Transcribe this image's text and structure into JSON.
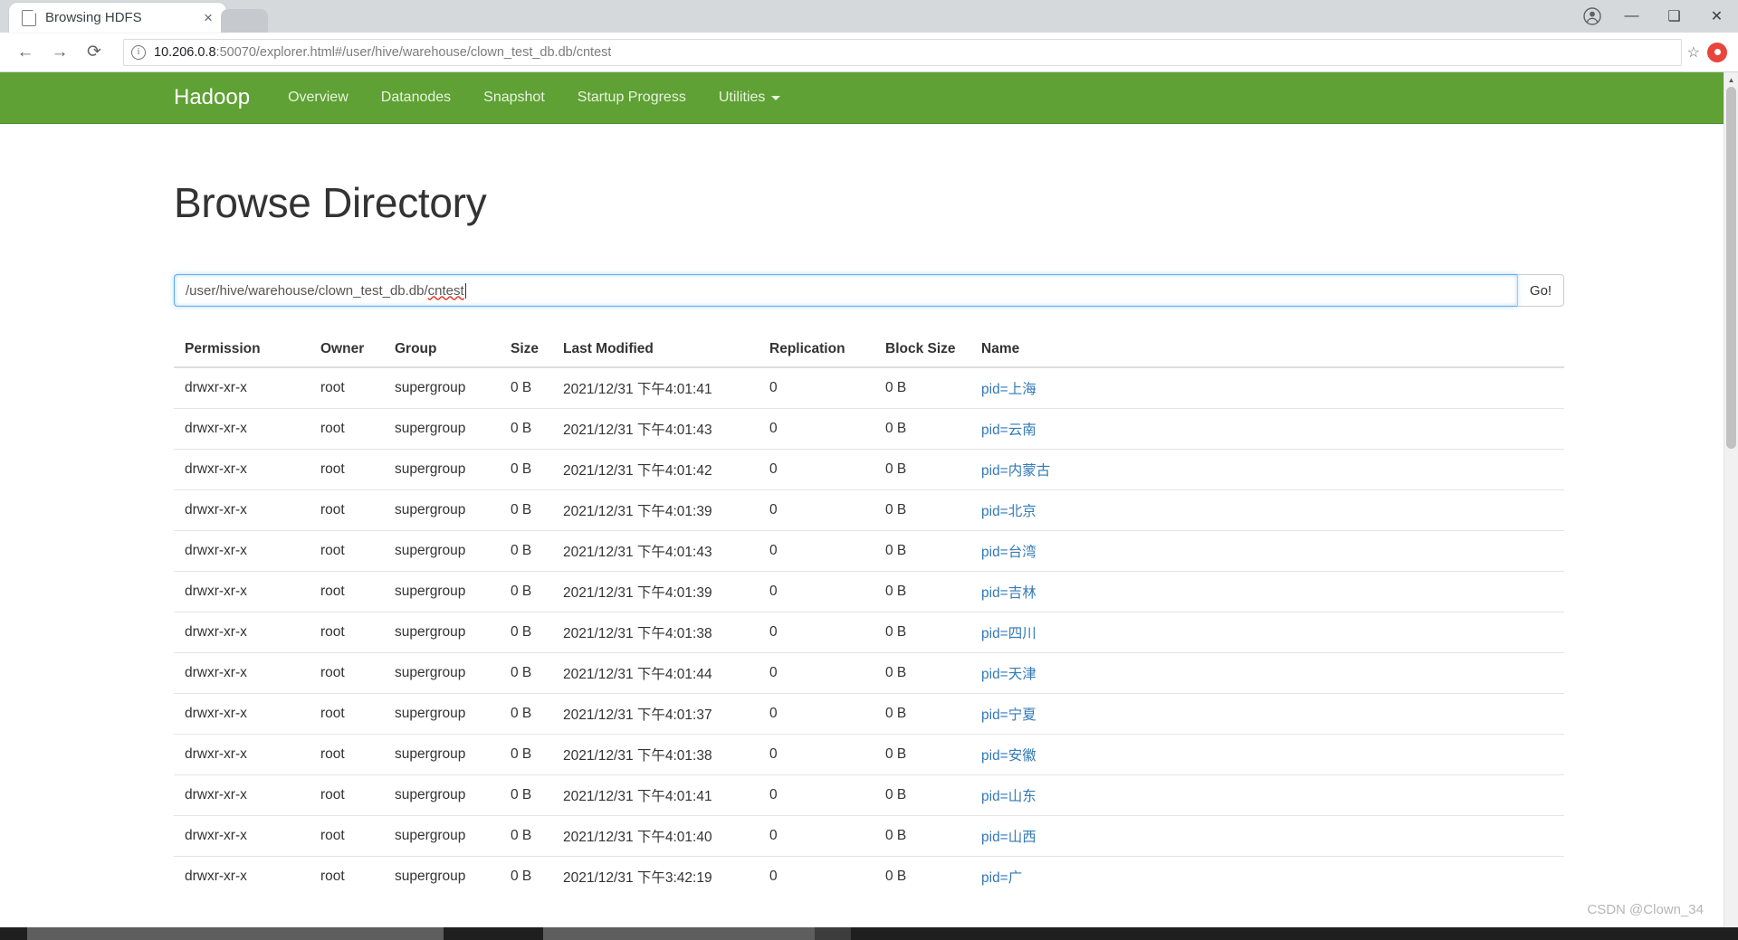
{
  "browser": {
    "tab_title": "Browsing HDFS",
    "tab_close": "×",
    "back_icon": "←",
    "forward_icon": "→",
    "reload_icon": "⟳",
    "info_icon": "i",
    "url_host": "10.206.0.8",
    "url_rest": ":50070/explorer.html#/user/hive/warehouse/clown_test_db.db/cntest",
    "star_icon": "☆",
    "profile_icon": "●",
    "minimize_label": "—",
    "maximize_label": "❑",
    "close_label": "✕"
  },
  "navbar": {
    "brand": "Hadoop",
    "links": [
      {
        "label": "Overview"
      },
      {
        "label": "Datanodes"
      },
      {
        "label": "Snapshot"
      },
      {
        "label": "Startup Progress"
      },
      {
        "label": "Utilities",
        "has_caret": true
      }
    ],
    "background": "#5fa134"
  },
  "page": {
    "title": "Browse Directory",
    "path_value": "/user/hive/warehouse/clown_test_db.db/",
    "path_value_misspelled": "cntest",
    "go_label": "Go!"
  },
  "table": {
    "headers": [
      "Permission",
      "Owner",
      "Group",
      "Size",
      "Last Modified",
      "Replication",
      "Block Size",
      "Name"
    ],
    "rows": [
      {
        "permission": "drwxr-xr-x",
        "owner": "root",
        "group": "supergroup",
        "size": "0 B",
        "modified": "2021/12/31 下午4:01:41",
        "replication": "0",
        "block_size": "0 B",
        "name": "pid=上海"
      },
      {
        "permission": "drwxr-xr-x",
        "owner": "root",
        "group": "supergroup",
        "size": "0 B",
        "modified": "2021/12/31 下午4:01:43",
        "replication": "0",
        "block_size": "0 B",
        "name": "pid=云南"
      },
      {
        "permission": "drwxr-xr-x",
        "owner": "root",
        "group": "supergroup",
        "size": "0 B",
        "modified": "2021/12/31 下午4:01:42",
        "replication": "0",
        "block_size": "0 B",
        "name": "pid=内蒙古"
      },
      {
        "permission": "drwxr-xr-x",
        "owner": "root",
        "group": "supergroup",
        "size": "0 B",
        "modified": "2021/12/31 下午4:01:39",
        "replication": "0",
        "block_size": "0 B",
        "name": "pid=北京"
      },
      {
        "permission": "drwxr-xr-x",
        "owner": "root",
        "group": "supergroup",
        "size": "0 B",
        "modified": "2021/12/31 下午4:01:43",
        "replication": "0",
        "block_size": "0 B",
        "name": "pid=台湾"
      },
      {
        "permission": "drwxr-xr-x",
        "owner": "root",
        "group": "supergroup",
        "size": "0 B",
        "modified": "2021/12/31 下午4:01:39",
        "replication": "0",
        "block_size": "0 B",
        "name": "pid=吉林"
      },
      {
        "permission": "drwxr-xr-x",
        "owner": "root",
        "group": "supergroup",
        "size": "0 B",
        "modified": "2021/12/31 下午4:01:38",
        "replication": "0",
        "block_size": "0 B",
        "name": "pid=四川"
      },
      {
        "permission": "drwxr-xr-x",
        "owner": "root",
        "group": "supergroup",
        "size": "0 B",
        "modified": "2021/12/31 下午4:01:44",
        "replication": "0",
        "block_size": "0 B",
        "name": "pid=天津"
      },
      {
        "permission": "drwxr-xr-x",
        "owner": "root",
        "group": "supergroup",
        "size": "0 B",
        "modified": "2021/12/31 下午4:01:37",
        "replication": "0",
        "block_size": "0 B",
        "name": "pid=宁夏"
      },
      {
        "permission": "drwxr-xr-x",
        "owner": "root",
        "group": "supergroup",
        "size": "0 B",
        "modified": "2021/12/31 下午4:01:38",
        "replication": "0",
        "block_size": "0 B",
        "name": "pid=安徽"
      },
      {
        "permission": "drwxr-xr-x",
        "owner": "root",
        "group": "supergroup",
        "size": "0 B",
        "modified": "2021/12/31 下午4:01:41",
        "replication": "0",
        "block_size": "0 B",
        "name": "pid=山东"
      },
      {
        "permission": "drwxr-xr-x",
        "owner": "root",
        "group": "supergroup",
        "size": "0 B",
        "modified": "2021/12/31 下午4:01:40",
        "replication": "0",
        "block_size": "0 B",
        "name": "pid=山西"
      },
      {
        "permission": "drwxr-xr-x",
        "owner": "root",
        "group": "supergroup",
        "size": "0 B",
        "modified": "2021/12/31 下午3:42:19",
        "replication": "0",
        "block_size": "0 B",
        "name": "pid=广"
      }
    ]
  },
  "scrollbar": {
    "up_arrow": "▲",
    "down_arrow": "▼"
  },
  "watermark": "CSDN @Clown_34"
}
